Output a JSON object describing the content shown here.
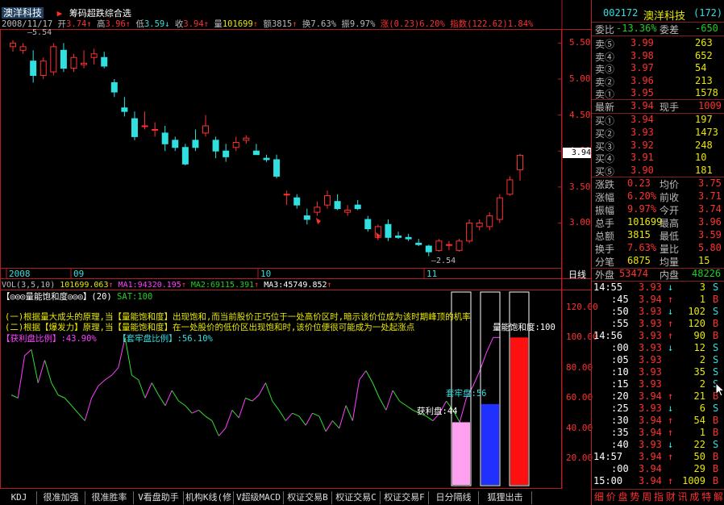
{
  "header": {
    "app_title": "澳洋科技",
    "sub_title": "筹码超跌综合选",
    "date": "2008/11/17",
    "open_label": "开",
    "open": "3.74",
    "high_label": "高",
    "high": "3.96",
    "low_label": "低",
    "low": "3.59",
    "close_label": "收",
    "close": "3.94",
    "vol_label": "量",
    "vol": "101699",
    "amt_label": "额",
    "amt": "3815",
    "turn_label": "换",
    "turn": "7.63%",
    "amp_label": "振",
    "amp": "9.97%",
    "chg_label": "涨",
    "chg": "(0.23)6.20%",
    "idx_label": "指数",
    "idx": "(122.62)1.84%"
  },
  "price_axis": [
    "5.50",
    "5.00",
    "4.50",
    "4.00",
    "3.50",
    "3.00"
  ],
  "price_marker": "3.94",
  "price_high_label": "5.54",
  "price_low_label": "2.54",
  "month_labels": [
    "2008",
    "09",
    "10",
    "11"
  ],
  "period_label": "日线",
  "volume_line": {
    "name": "VOL(3,5,10)",
    "value": "101699.063",
    "ma1": "MA1:94320.195",
    "ma2": "MA2:69115.391",
    "ma3": "MA3:45749.852"
  },
  "indicator": {
    "title": "【◎◎◎量能饱和度◎◎◎】(20)",
    "sat": "SAT:100",
    "note1": "(一)根据量大成头的原理,当【量能饱和度】出现饱和,而当前股价正巧位于一处高价区时,暗示该价位成为该时期峰顶的机率",
    "note2": "(二)根据【爆发力】原理,当【量能饱和度】在一处股价的低价区出现饱和时,该价位便很可能成为一处起涨点",
    "sat_label": "量能饱和度:100",
    "profit_label": "【获利盘比例】",
    "profit_value": ":43.90%",
    "trap_label": "【套牢盘比例】",
    "trap_value": ":56.10%",
    "trap_bar_label": "套牢盘:56",
    "profit_bar_label": "获利盘:44",
    "axis": [
      "120.00",
      "100.00",
      "80.00",
      "60.00",
      "40.00",
      "20.00"
    ]
  },
  "chart_data": {
    "type": "candlestick",
    "title": "",
    "ylim": [
      2.4,
      5.65
    ],
    "candles": [
      {
        "o": 5.45,
        "h": 5.54,
        "l": 5.38,
        "c": 5.5
      },
      {
        "o": 5.4,
        "h": 5.5,
        "l": 5.35,
        "c": 5.45
      },
      {
        "o": 5.25,
        "h": 5.4,
        "l": 4.95,
        "c": 5.05
      },
      {
        "o": 5.05,
        "h": 5.3,
        "l": 5.0,
        "c": 5.25
      },
      {
        "o": 5.1,
        "h": 5.5,
        "l": 5.05,
        "c": 5.45
      },
      {
        "o": 5.4,
        "h": 5.5,
        "l": 5.1,
        "c": 5.15
      },
      {
        "o": 5.15,
        "h": 5.35,
        "l": 5.1,
        "c": 5.3
      },
      {
        "o": 5.2,
        "h": 5.4,
        "l": 5.15,
        "c": 5.22
      },
      {
        "o": 5.3,
        "h": 5.42,
        "l": 5.2,
        "c": 5.35
      },
      {
        "o": 5.3,
        "h": 5.38,
        "l": 5.15,
        "c": 5.18
      },
      {
        "o": 4.95,
        "h": 5.0,
        "l": 4.75,
        "c": 4.82
      },
      {
        "o": 4.6,
        "h": 4.75,
        "l": 4.48,
        "c": 4.55
      },
      {
        "o": 4.45,
        "h": 4.55,
        "l": 4.15,
        "c": 4.2
      },
      {
        "o": 4.35,
        "h": 4.55,
        "l": 4.3,
        "c": 4.35
      },
      {
        "o": 4.3,
        "h": 4.4,
        "l": 4.2,
        "c": 4.3
      },
      {
        "o": 4.25,
        "h": 4.35,
        "l": 4.0,
        "c": 4.1
      },
      {
        "o": 4.15,
        "h": 4.2,
        "l": 4.0,
        "c": 4.05
      },
      {
        "o": 4.05,
        "h": 4.1,
        "l": 3.8,
        "c": 3.82
      },
      {
        "o": 4.15,
        "h": 4.3,
        "l": 4.0,
        "c": 4.05
      },
      {
        "o": 4.25,
        "h": 4.5,
        "l": 4.2,
        "c": 4.35
      },
      {
        "o": 4.15,
        "h": 4.2,
        "l": 3.9,
        "c": 4.0
      },
      {
        "o": 4.0,
        "h": 4.1,
        "l": 3.85,
        "c": 3.92
      },
      {
        "o": 4.05,
        "h": 4.2,
        "l": 4.0,
        "c": 4.12
      },
      {
        "o": 4.15,
        "h": 4.22,
        "l": 4.1,
        "c": 4.18
      },
      {
        "o": 4.0,
        "h": 4.1,
        "l": 3.95,
        "c": 3.95
      },
      {
        "o": 3.9,
        "h": 3.95,
        "l": 3.85,
        "c": 3.88
      },
      {
        "o": 3.88,
        "h": 3.95,
        "l": 3.62,
        "c": 3.65
      },
      {
        "o": 3.4,
        "h": 3.45,
        "l": 3.25,
        "c": 3.4
      },
      {
        "o": 3.35,
        "h": 3.4,
        "l": 3.2,
        "c": 3.25
      },
      {
        "o": 3.1,
        "h": 3.2,
        "l": 2.98,
        "c": 3.05
      },
      {
        "o": 3.15,
        "h": 3.3,
        "l": 3.1,
        "c": 3.22
      },
      {
        "o": 3.25,
        "h": 3.45,
        "l": 3.2,
        "c": 3.38
      },
      {
        "o": 3.3,
        "h": 3.4,
        "l": 3.18,
        "c": 3.2
      },
      {
        "o": 3.15,
        "h": 3.25,
        "l": 3.1,
        "c": 3.18
      },
      {
        "o": 3.25,
        "h": 3.32,
        "l": 3.18,
        "c": 3.2
      },
      {
        "o": 3.05,
        "h": 3.1,
        "l": 2.88,
        "c": 2.92
      },
      {
        "o": 2.8,
        "h": 2.98,
        "l": 2.76,
        "c": 2.95
      },
      {
        "o": 2.98,
        "h": 3.05,
        "l": 2.75,
        "c": 2.8
      },
      {
        "o": 2.82,
        "h": 2.88,
        "l": 2.78,
        "c": 2.8
      },
      {
        "o": 2.8,
        "h": 2.85,
        "l": 2.75,
        "c": 2.78
      },
      {
        "o": 2.72,
        "h": 2.78,
        "l": 2.68,
        "c": 2.7
      },
      {
        "o": 2.68,
        "h": 2.7,
        "l": 2.54,
        "c": 2.6
      },
      {
        "o": 2.62,
        "h": 2.78,
        "l": 2.6,
        "c": 2.75
      },
      {
        "o": 2.7,
        "h": 2.75,
        "l": 2.62,
        "c": 2.7
      },
      {
        "o": 2.62,
        "h": 2.78,
        "l": 2.6,
        "c": 2.75
      },
      {
        "o": 2.75,
        "h": 3.05,
        "l": 2.72,
        "c": 3.0
      },
      {
        "o": 2.95,
        "h": 3.05,
        "l": 2.9,
        "c": 3.0
      },
      {
        "o": 2.95,
        "h": 3.15,
        "l": 2.9,
        "c": 3.1
      },
      {
        "o": 3.05,
        "h": 3.4,
        "l": 3.0,
        "c": 3.35
      },
      {
        "o": 3.4,
        "h": 3.65,
        "l": 3.38,
        "c": 3.6
      },
      {
        "o": 3.74,
        "h": 3.96,
        "l": 3.59,
        "c": 3.94
      }
    ],
    "indicator_series": {
      "ylim": [
        0,
        130
      ],
      "values": [
        62,
        60,
        88,
        92,
        70,
        85,
        70,
        62,
        60,
        55,
        50,
        45,
        60,
        68,
        72,
        75,
        80,
        100,
        75,
        72,
        60,
        70,
        62,
        55,
        65,
        58,
        55,
        50,
        52,
        48,
        45,
        35,
        40,
        52,
        47,
        60,
        58,
        62,
        70,
        58,
        52,
        45,
        50,
        48,
        42,
        50,
        48,
        38,
        45,
        40,
        55,
        45,
        72,
        78,
        70,
        60,
        52,
        65,
        58,
        55,
        52,
        50,
        48,
        45,
        50,
        58,
        52,
        44,
        60,
        68,
        78,
        90,
        100,
        100
      ],
      "trap_pct": 56,
      "profit_pct": 44,
      "sat": 100
    }
  },
  "quote": {
    "code": "002172",
    "name": "澳洋科技",
    "rank": "(172)",
    "webi_label": "委比",
    "webi": "-13.36%",
    "weicha_label": "委差",
    "weicha": "-650",
    "sells": [
      {
        "label": "卖⑤",
        "price": "3.99",
        "vol": "263"
      },
      {
        "label": "卖④",
        "price": "3.98",
        "vol": "652"
      },
      {
        "label": "卖③",
        "price": "3.97",
        "vol": "54"
      },
      {
        "label": "卖②",
        "price": "3.96",
        "vol": "213"
      },
      {
        "label": "卖①",
        "price": "3.95",
        "vol": "1578"
      }
    ],
    "latest_label": "最新",
    "latest": "3.94",
    "xianshou_label": "现手",
    "xianshou": "1009",
    "buys": [
      {
        "label": "买①",
        "price": "3.94",
        "vol": "197"
      },
      {
        "label": "买②",
        "price": "3.93",
        "vol": "1473"
      },
      {
        "label": "买③",
        "price": "3.92",
        "vol": "248"
      },
      {
        "label": "买④",
        "price": "3.91",
        "vol": "10"
      },
      {
        "label": "买⑤",
        "price": "3.90",
        "vol": "181"
      }
    ],
    "stats": [
      {
        "l1": "涨跌",
        "v1": "0.23",
        "l2": "均价",
        "v2": "3.75"
      },
      {
        "l1": "涨幅",
        "v1": "6.20%",
        "l2": "前收",
        "v2": "3.71"
      },
      {
        "l1": "振幅",
        "v1": "9.97%",
        "l2": "今开",
        "v2": "3.74"
      },
      {
        "l1": "总手",
        "v1": "101699",
        "l2": "最高",
        "v2": "3.96"
      },
      {
        "l1": "总额",
        "v1": "3815",
        "l2": "最低",
        "v2": "3.59"
      },
      {
        "l1": "换手",
        "v1": "7.63%",
        "l2": "量比",
        "v2": "5.80"
      },
      {
        "l1": "分笔",
        "v1": "6875",
        "l2": "均量",
        "v2": "15"
      }
    ],
    "outer_label": "外盘",
    "outer": "53474",
    "inner_label": "内盘",
    "inner": "48226",
    "ticks": [
      {
        "t": "14:55",
        "p": "3.93",
        "a": "↓",
        "v": "3",
        "f": "S"
      },
      {
        "t": ":45",
        "p": "3.94",
        "a": "↑",
        "v": "1",
        "f": "B"
      },
      {
        "t": ":50",
        "p": "3.93",
        "a": "↓",
        "v": "102",
        "f": "S"
      },
      {
        "t": ":55",
        "p": "3.93",
        "a": "↑",
        "v": "120",
        "f": "B"
      },
      {
        "t": "14:56",
        "p": "3.93",
        "a": "↑",
        "v": "90",
        "f": "B"
      },
      {
        "t": ":00",
        "p": "3.93",
        "a": "↓",
        "v": "12",
        "f": "S"
      },
      {
        "t": ":05",
        "p": "3.93",
        "a": "",
        "v": "2",
        "f": "S"
      },
      {
        "t": ":10",
        "p": "3.93",
        "a": "",
        "v": "35",
        "f": "S"
      },
      {
        "t": ":15",
        "p": "3.93",
        "a": "",
        "v": "2",
        "f": "S"
      },
      {
        "t": ":20",
        "p": "3.94",
        "a": "↑",
        "v": "21",
        "f": "B"
      },
      {
        "t": ":25",
        "p": "3.93",
        "a": "↓",
        "v": "6",
        "f": "S"
      },
      {
        "t": ":30",
        "p": "3.94",
        "a": "↑",
        "v": "54",
        "f": "B"
      },
      {
        "t": ":35",
        "p": "3.94",
        "a": "↑",
        "v": "1",
        "f": "B"
      },
      {
        "t": ":40",
        "p": "3.93",
        "a": "↓",
        "v": "22",
        "f": "S"
      },
      {
        "t": "14:57",
        "p": "3.94",
        "a": "↑",
        "v": "50",
        "f": "B"
      },
      {
        "t": ":00",
        "p": "3.94",
        "a": "",
        "v": "29",
        "f": "B"
      },
      {
        "t": "15:00",
        "p": "3.94",
        "a": "↑",
        "v": "1009",
        "f": "B"
      }
    ],
    "bottom_tabs": [
      "细",
      "价",
      "盘",
      "势",
      "周",
      "指",
      "财",
      "讯",
      "成",
      "特",
      "解"
    ]
  },
  "bottom_tabs": [
    "KDJ",
    "很准加强",
    "很准胜率",
    "V看盘助手",
    "机构K线(修",
    "V超级MACD",
    "权证交易B",
    "权证交易C",
    "权证交易F",
    "日分隔线",
    "狐狸出击"
  ]
}
